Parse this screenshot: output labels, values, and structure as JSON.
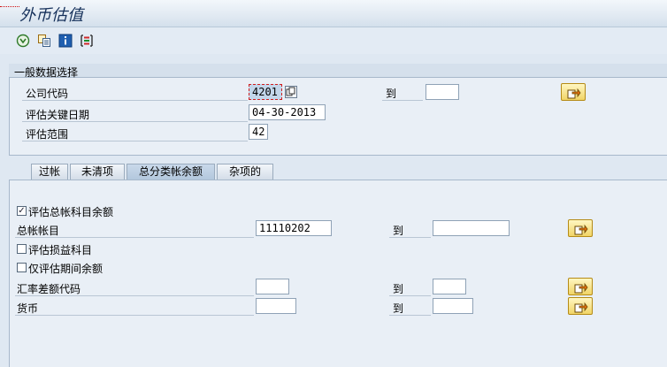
{
  "window": {
    "title": "外币估值"
  },
  "toolbar": {
    "icons": [
      "execute-icon",
      "copy-variant-icon",
      "info-icon",
      "selection-options-icon"
    ]
  },
  "general_selection": {
    "title": "一般数据选择",
    "company_code_label": "公司代码",
    "company_code_value": "4201",
    "to_label": "到",
    "company_code_to_value": "",
    "key_date_label": "评估关键日期",
    "key_date_value": "04-30-2013",
    "valuation_area_label": "评估范围",
    "valuation_area_value": "42"
  },
  "tabs": [
    {
      "label": "过帐"
    },
    {
      "label": "未清项"
    },
    {
      "label": "总分类帐余额",
      "active": true
    },
    {
      "label": "杂项的"
    }
  ],
  "gl_balances": {
    "valuate_gl_balances_label": "评估总帐科目余额",
    "valuate_gl_balances_checked": true,
    "gl_account_label": "总帐帐目",
    "gl_account_from": "11110202",
    "gl_account_to": "",
    "to_label": "到",
    "valuate_pl_accounts_label": "评估损益科目",
    "valuate_pl_accounts_checked": false,
    "period_balances_only_label": "仅评估期间余额",
    "period_balances_only_checked": false,
    "exch_diff_key_label": "汇率差额代码",
    "exch_diff_key_from": "",
    "exch_diff_key_to": "",
    "currency_label": "货币",
    "currency_from": "",
    "currency_to": ""
  },
  "colors": {
    "accent": "#15305a",
    "button_yellow": "#f1d466",
    "panel": "#e9eff6"
  }
}
